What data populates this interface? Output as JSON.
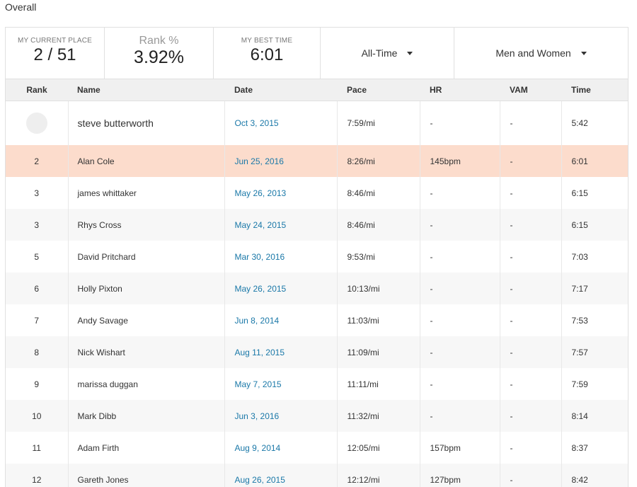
{
  "section": {
    "title": "Overall"
  },
  "stats": {
    "current_place_label": "MY CURRENT PLACE",
    "current_place_value": "2 / 51",
    "rank_pct_label": "Rank %",
    "rank_pct_value": "3.92%",
    "best_time_label": "MY BEST TIME",
    "best_time_value": "6:01"
  },
  "filters": {
    "period": "All-Time",
    "gender": "Men and Women"
  },
  "table": {
    "headers": {
      "rank": "Rank",
      "name": "Name",
      "date": "Date",
      "pace": "Pace",
      "hr": "HR",
      "vam": "VAM",
      "time": "Time"
    },
    "athlete_row": {
      "rank": "",
      "name": "steve butterworth",
      "date": "Oct 3, 2015",
      "pace": "7:59/mi",
      "hr": "-",
      "vam": "-",
      "time": "5:42"
    },
    "rows": [
      {
        "rank": "2",
        "name": "Alan Cole",
        "date": "Jun 25, 2016",
        "pace": "8:26/mi",
        "hr": "145bpm",
        "vam": "-",
        "time": "6:01",
        "highlight": true
      },
      {
        "rank": "3",
        "name": "james whittaker",
        "date": "May 26, 2013",
        "pace": "8:46/mi",
        "hr": "-",
        "vam": "-",
        "time": "6:15"
      },
      {
        "rank": "3",
        "name": "Rhys Cross",
        "date": "May 24, 2015",
        "pace": "8:46/mi",
        "hr": "-",
        "vam": "-",
        "time": "6:15"
      },
      {
        "rank": "5",
        "name": "David Pritchard",
        "date": "Mar 30, 2016",
        "pace": "9:53/mi",
        "hr": "-",
        "vam": "-",
        "time": "7:03"
      },
      {
        "rank": "6",
        "name": "Holly Pixton",
        "date": "May 26, 2015",
        "pace": "10:13/mi",
        "hr": "-",
        "vam": "-",
        "time": "7:17"
      },
      {
        "rank": "7",
        "name": "Andy Savage",
        "date": "Jun 8, 2014",
        "pace": "11:03/mi",
        "hr": "-",
        "vam": "-",
        "time": "7:53"
      },
      {
        "rank": "8",
        "name": "Nick Wishart",
        "date": "Aug 11, 2015",
        "pace": "11:09/mi",
        "hr": "-",
        "vam": "-",
        "time": "7:57"
      },
      {
        "rank": "9",
        "name": "marissa duggan",
        "date": "May 7, 2015",
        "pace": "11:11/mi",
        "hr": "-",
        "vam": "-",
        "time": "7:59"
      },
      {
        "rank": "10",
        "name": "Mark Dibb",
        "date": "Jun 3, 2016",
        "pace": "11:32/mi",
        "hr": "-",
        "vam": "-",
        "time": "8:14"
      },
      {
        "rank": "11",
        "name": "Adam Firth",
        "date": "Aug 9, 2014",
        "pace": "12:05/mi",
        "hr": "157bpm",
        "vam": "-",
        "time": "8:37"
      },
      {
        "rank": "12",
        "name": "Gareth Jones",
        "date": "Aug 26, 2015",
        "pace": "12:12/mi",
        "hr": "127bpm",
        "vam": "-",
        "time": "8:42"
      }
    ]
  }
}
